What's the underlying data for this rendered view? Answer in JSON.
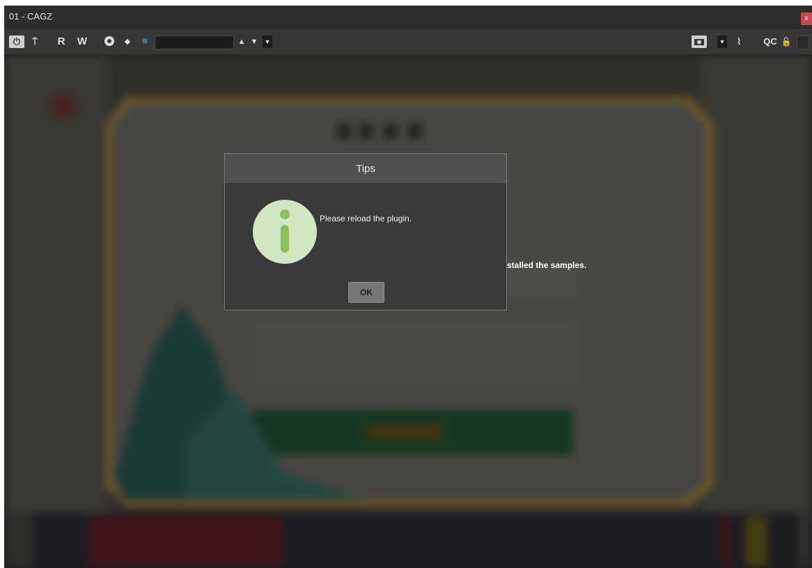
{
  "window": {
    "title": "01 - CAGZ",
    "close_label": "x"
  },
  "toolbar": {
    "power_icon": "power-icon",
    "read_label": "R",
    "write_label": "W",
    "quick_controls_label": "QC",
    "search_value": ""
  },
  "background_message": "stalled the samples.",
  "dialog": {
    "title": "Tips",
    "message": "Please reload the plugin.",
    "ok_label": "OK",
    "icon": "info-icon"
  },
  "colors": {
    "close_red": "#d3464f",
    "info_green": "#8bc15c",
    "info_bg": "#cfe8c3",
    "install_button_green": "#1f6b3a"
  }
}
